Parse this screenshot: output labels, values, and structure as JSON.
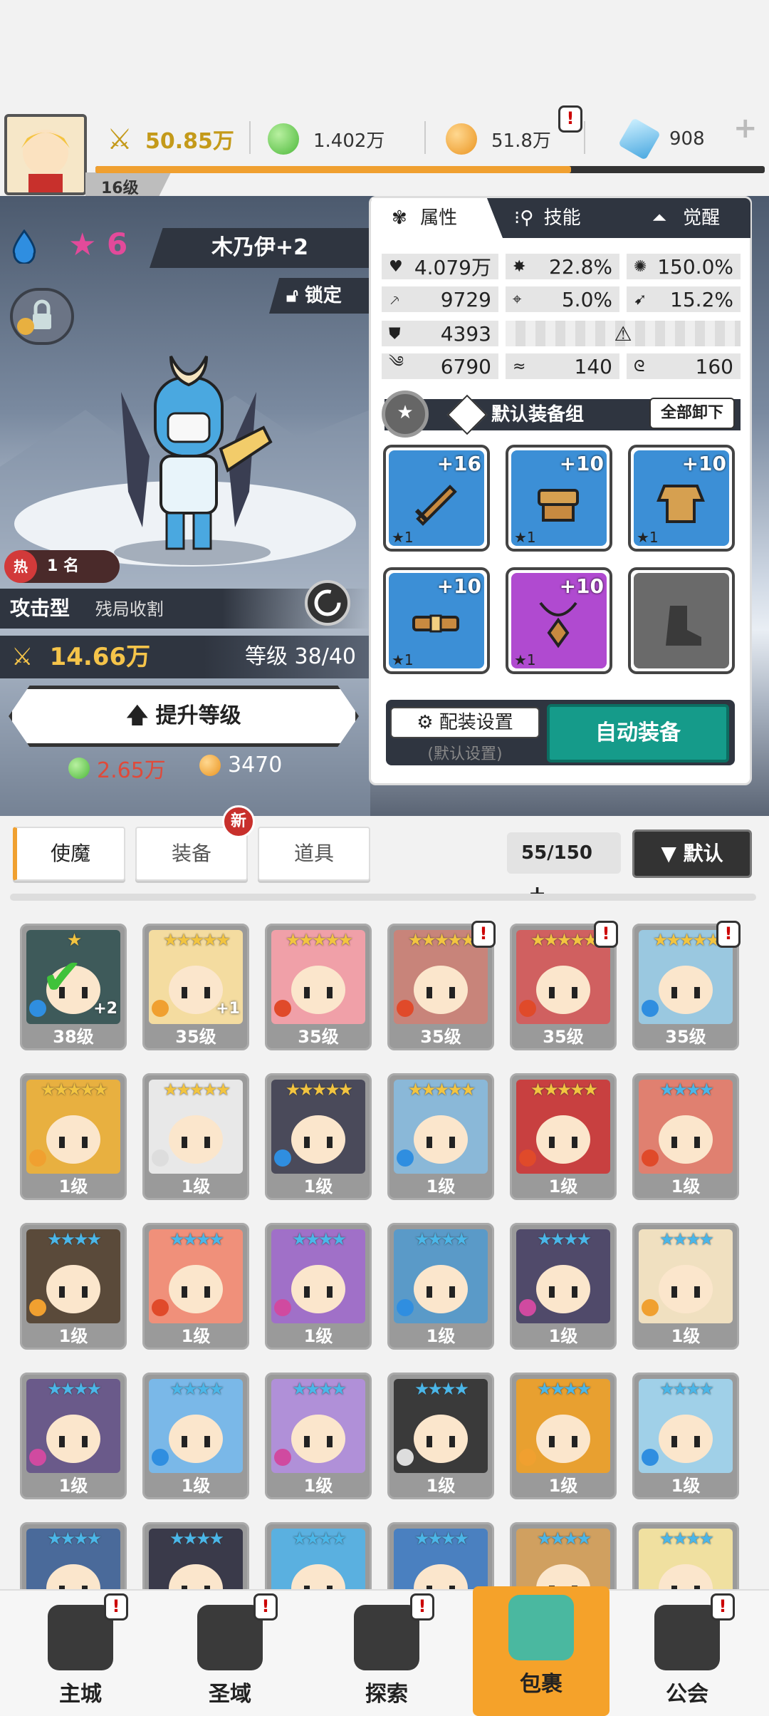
{
  "player": {
    "level": "16级"
  },
  "currencies": [
    {
      "name": "power",
      "value": "50.85万",
      "color": "#c49a1a"
    },
    {
      "name": "green-gem",
      "value": "1.402万",
      "color": "#5ccf4a"
    },
    {
      "name": "gold-coin",
      "value": "51.8万",
      "color": "#f0a030"
    },
    {
      "name": "diamond",
      "value": "908",
      "color": "#6cc6f0"
    }
  ],
  "hero": {
    "stars": "6",
    "name": "木乃伊+2",
    "lock_label": "锁定",
    "rank_prefix": "热",
    "rank": "1 名",
    "type": "攻击型",
    "type_sub": "残局收割",
    "power": "14.66万",
    "level_text": "等级 38/40",
    "upgrade_label": "提升等级",
    "cost_green": "2.65万",
    "cost_gold": "3470"
  },
  "panel": {
    "tabs": [
      "属性",
      "技能",
      "觉醒"
    ],
    "stats": {
      "hp": "4.079万",
      "crit": "22.8%",
      "crit_dmg": "150.0%",
      "atk": "9729",
      "accuracy": "5.0%",
      "dodge": "15.2%",
      "def": "4393",
      "speed": "6790",
      "stat_a": "140",
      "stat_b": "160"
    },
    "gear_group_label": "默认装备组",
    "unequip_all": "全部卸下",
    "gear": [
      {
        "plus": "+16",
        "stars": "★1",
        "type": "sword",
        "color": "#3c8fd6"
      },
      {
        "plus": "+10",
        "stars": "★1",
        "type": "helmet",
        "color": "#3c8fd6"
      },
      {
        "plus": "+10",
        "stars": "★1",
        "type": "armor",
        "color": "#3c8fd6"
      },
      {
        "plus": "+10",
        "stars": "★1",
        "type": "belt",
        "color": "#3c8fd6"
      },
      {
        "plus": "+10",
        "stars": "★1",
        "type": "necklace",
        "color": "#b04ad0"
      },
      {
        "plus": "",
        "stars": "",
        "type": "boots-empty",
        "color": "#6a6a6a"
      }
    ],
    "config_label": "配装设置",
    "config_sub": "(默认设置)",
    "auto_equip": "自动装备"
  },
  "filters": {
    "tabs": [
      "使魔",
      "装备",
      "道具"
    ],
    "new_badge": "新",
    "count": "55/150",
    "sort": "▼ 默认"
  },
  "heroes": [
    {
      "level": "38级",
      "stars": "★",
      "plus": "+2",
      "elem": "#2f8ee0",
      "color": "#3e5a5a"
    },
    {
      "level": "35级",
      "stars": "★★★★★",
      "plus": "+1",
      "elem": "#f0a030",
      "color": "#f4dca0"
    },
    {
      "level": "35级",
      "stars": "★★★★★",
      "plus": "",
      "elem": "#e04a2a",
      "color": "#f0a0a8"
    },
    {
      "level": "35级",
      "stars": "★★★★★",
      "plus": "",
      "elem": "#e04a2a",
      "color": "#c8847a"
    },
    {
      "level": "35级",
      "stars": "★★★★★",
      "plus": "",
      "elem": "#e04a2a",
      "color": "#d06060"
    },
    {
      "level": "35级",
      "stars": "★★★★★",
      "plus": "",
      "elem": "#2f8ee0",
      "color": "#9ac8e0"
    },
    {
      "level": "1级",
      "stars": "★★★★★",
      "plus": "",
      "elem": "#f0a030",
      "color": "#e8b040"
    },
    {
      "level": "1级",
      "stars": "★★★★★",
      "plus": "",
      "elem": "#dddddd",
      "color": "#e8e8e8"
    },
    {
      "level": "1级",
      "stars": "★★★★★",
      "plus": "",
      "elem": "#2f8ee0",
      "color": "#4a4a5a"
    },
    {
      "level": "1级",
      "stars": "★★★★★",
      "plus": "",
      "elem": "#2f8ee0",
      "color": "#8ab8d8"
    },
    {
      "level": "1级",
      "stars": "★★★★★",
      "plus": "",
      "elem": "#e04a2a",
      "color": "#c84040"
    },
    {
      "level": "1级",
      "stars": "★★★★",
      "plus": "",
      "elem": "#e04a2a",
      "color": "#e08070"
    },
    {
      "level": "1级",
      "stars": "★★★★",
      "plus": "",
      "elem": "#f0a030",
      "color": "#5a4a3a"
    },
    {
      "level": "1级",
      "stars": "★★★★",
      "plus": "",
      "elem": "#e04a2a",
      "color": "#f0907a"
    },
    {
      "level": "1级",
      "stars": "★★★★",
      "plus": "",
      "elem": "#d04aa0",
      "color": "#a070c8"
    },
    {
      "level": "1级",
      "stars": "★★★★",
      "plus": "",
      "elem": "#2f8ee0",
      "color": "#5a9ac8"
    },
    {
      "level": "1级",
      "stars": "★★★★",
      "plus": "",
      "elem": "#d04aa0",
      "color": "#504a6a"
    },
    {
      "level": "1级",
      "stars": "★★★★",
      "plus": "",
      "elem": "#f0a030",
      "color": "#f0e0c0"
    },
    {
      "level": "1级",
      "stars": "★★★★",
      "plus": "",
      "elem": "#d04aa0",
      "color": "#6a5a8a"
    },
    {
      "level": "1级",
      "stars": "★★★★",
      "plus": "",
      "elem": "#2f8ee0",
      "color": "#7ab8e8"
    },
    {
      "level": "1级",
      "stars": "★★★★",
      "plus": "",
      "elem": "#d04aa0",
      "color": "#b090d8"
    },
    {
      "level": "1级",
      "stars": "★★★★",
      "plus": "",
      "elem": "#dddddd",
      "color": "#3a3a3a"
    },
    {
      "level": "1级",
      "stars": "★★★★",
      "plus": "",
      "elem": "#f0a030",
      "color": "#e8a030"
    },
    {
      "level": "1级",
      "stars": "★★★★",
      "plus": "",
      "elem": "#2f8ee0",
      "color": "#a0d0e8"
    },
    {
      "level": "",
      "stars": "★★★★",
      "plus": "",
      "elem": "",
      "color": "#4a6a9a"
    },
    {
      "level": "",
      "stars": "★★★★",
      "plus": "",
      "elem": "",
      "color": "#3a3a4a"
    },
    {
      "level": "",
      "stars": "★★★★",
      "plus": "",
      "elem": "",
      "color": "#5ab0e0"
    },
    {
      "level": "",
      "stars": "★★★★",
      "plus": "",
      "elem": "",
      "color": "#4a80c0"
    },
    {
      "level": "",
      "stars": "★★★★",
      "plus": "",
      "elem": "",
      "color": "#d0a060"
    },
    {
      "level": "",
      "stars": "★★★★",
      "plus": "",
      "elem": "",
      "color": "#f0e0a0"
    }
  ],
  "nav": [
    {
      "label": "主城",
      "icon": "castle-icon"
    },
    {
      "label": "圣域",
      "icon": "portal-icon"
    },
    {
      "label": "探索",
      "icon": "sword-stone-icon"
    },
    {
      "label": "包裹",
      "icon": "bag-icon"
    },
    {
      "label": "公会",
      "icon": "guild-icon"
    }
  ]
}
